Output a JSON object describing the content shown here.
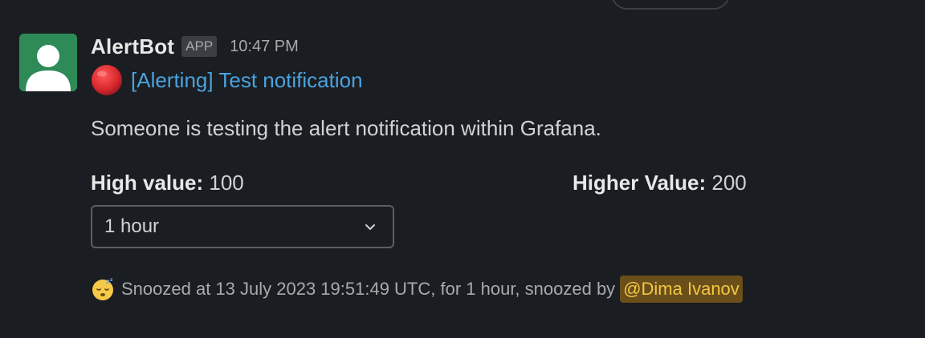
{
  "message": {
    "sender": "AlertBot",
    "app_badge": "APP",
    "timestamp": "10:47 PM",
    "title_icon": "red-circle-emoji",
    "title": "[Alerting] Test notification",
    "description": "Someone is testing the alert notification within Grafana.",
    "fields": [
      {
        "label": "High value:",
        "value": "100"
      },
      {
        "label": "Higher Value:",
        "value": "200"
      }
    ],
    "snooze_select": {
      "value": "1 hour",
      "icon": "chevron-down-icon"
    },
    "context": {
      "icon": "sleeping-face-emoji",
      "text": "Snoozed at 13 July 2023 19:51:49 UTC, for 1 hour, snoozed by",
      "mention": "@Dima Ivanov"
    }
  },
  "colors": {
    "background": "#1a1d21",
    "link": "#4aa3df",
    "avatar_bg": "#2e8b57",
    "mention_bg": "#6b4f1a",
    "mention_text": "#f2c744",
    "alert_red": "#d8282f"
  }
}
